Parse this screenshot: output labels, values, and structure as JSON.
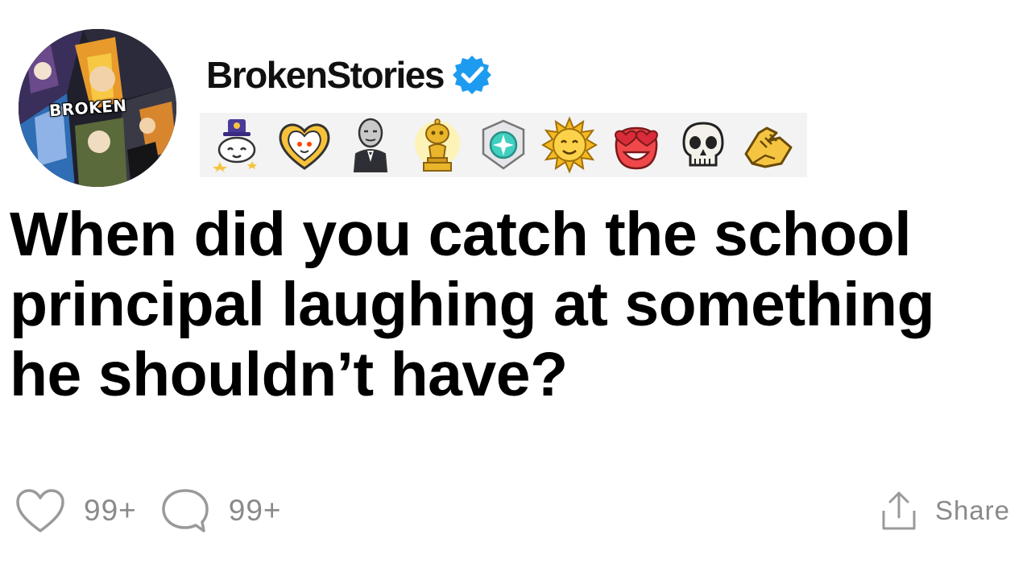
{
  "post": {
    "avatar_text": "BROKEN",
    "username": "BrokenStories",
    "verified_icon": "verified-check-icon",
    "title": "When did you catch the school principal laughing at something he shouldn’t have?"
  },
  "awards": [
    {
      "name": "snoo-party-hat-award-icon"
    },
    {
      "name": "heart-snoo-award-icon"
    },
    {
      "name": "gentleman-award-icon"
    },
    {
      "name": "gold-trophy-snoo-award-icon"
    },
    {
      "name": "platinum-gem-award-icon"
    },
    {
      "name": "sun-face-award-icon"
    },
    {
      "name": "heart-eyes-award-icon"
    },
    {
      "name": "skull-award-icon"
    },
    {
      "name": "handshake-award-icon"
    }
  ],
  "footer": {
    "like_count": "99+",
    "comment_count": "99+",
    "share_label": "Share"
  },
  "colors": {
    "verified": "#1d9bf0",
    "muted_text": "#8a8a8a",
    "award_strip": "#f3f3f3"
  }
}
